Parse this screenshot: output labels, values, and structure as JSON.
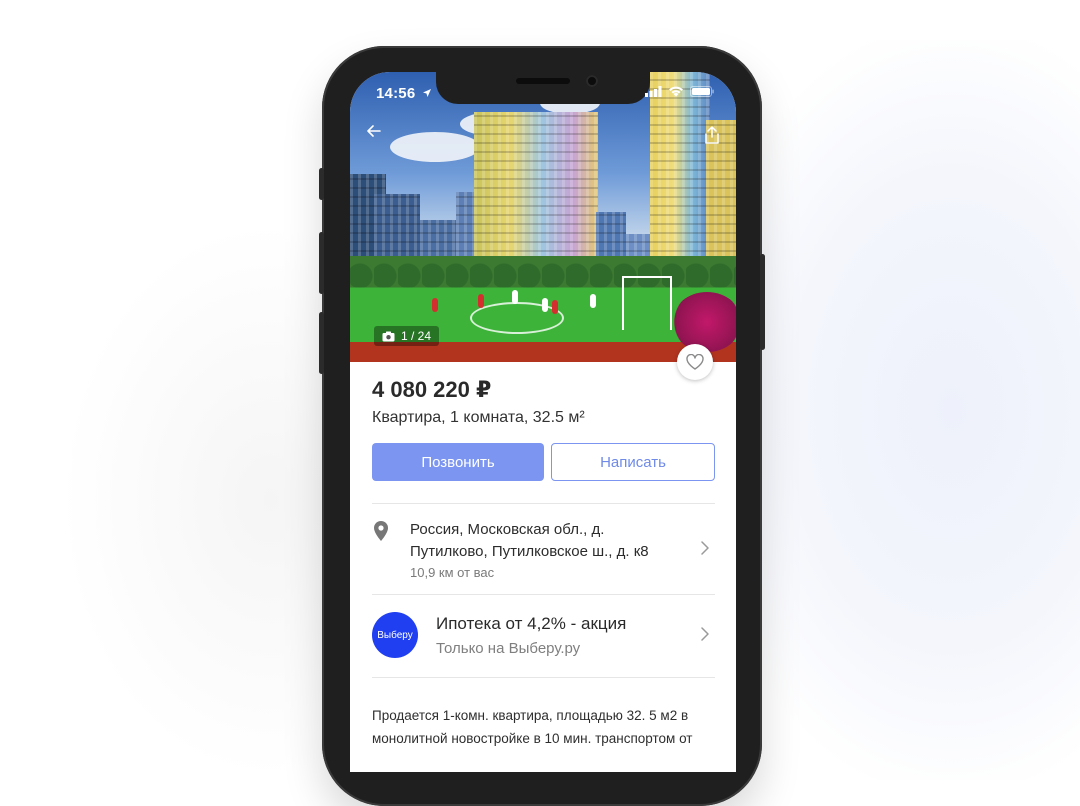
{
  "status_bar": {
    "time": "14:56"
  },
  "gallery": {
    "counter": "1 / 24"
  },
  "listing": {
    "price": "4 080 220 ₽",
    "subtitle": "Квартира, 1 комната, 32.5 м²"
  },
  "actions": {
    "call_label": "Позвонить",
    "message_label": "Написать"
  },
  "address": {
    "line1": "Россия, Московская обл., д.",
    "line2": "Путилково, Путилковское ш., д. к8",
    "distance": "10,9 км от вас"
  },
  "promo": {
    "logo_text": "Выберу",
    "title": "Ипотека от 4,2% - акция",
    "subtitle": "Только на Выберу.ру"
  },
  "description": {
    "line1": "Продается 1-комн. квартира, площадью 32. 5 м2 в",
    "line2": "монолитной новостройке в 10 мин. транспортом от"
  },
  "icons": [
    "back-arrow-icon",
    "share-icon",
    "camera-icon",
    "heart-icon",
    "location-pin-icon",
    "chevron-right-icon",
    "signal-icon",
    "wifi-icon",
    "battery-icon",
    "location-arrow-icon"
  ],
  "colors": {
    "accent": "#7b95f0",
    "promo_logo": "#1f3ff0"
  }
}
